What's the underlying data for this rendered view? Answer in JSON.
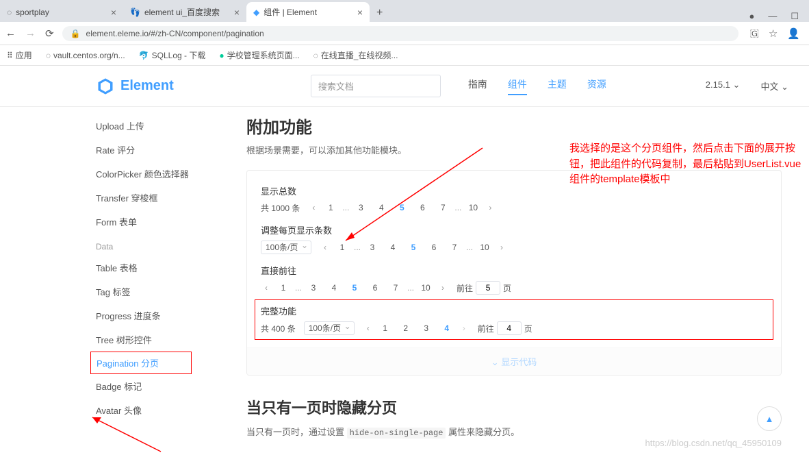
{
  "browser": {
    "tabs": [
      {
        "title": "sportplay"
      },
      {
        "title": "element ui_百度搜索"
      },
      {
        "title": "组件 | Element"
      }
    ],
    "url": "element.eleme.io/#/zh-CN/component/pagination",
    "bookmarks": [
      {
        "label": "应用"
      },
      {
        "label": "vault.centos.org/n..."
      },
      {
        "label": "SQLLog - 下载"
      },
      {
        "label": "学校管理系统页面..."
      },
      {
        "label": "在线直播_在线视频..."
      }
    ]
  },
  "header": {
    "brand": "Element",
    "search_placeholder": "搜索文档",
    "nav": [
      "指南",
      "组件",
      "主题",
      "资源"
    ],
    "version": "2.15.1",
    "lang": "中文"
  },
  "sidebar": {
    "items": [
      "Upload 上传",
      "Rate 评分",
      "ColorPicker 颜色选择器",
      "Transfer 穿梭框",
      "Form 表单"
    ],
    "group": "Data",
    "data_items": [
      "Table 表格",
      "Tag 标签",
      "Progress 进度条",
      "Tree 树形控件",
      "Pagination 分页",
      "Badge 标记",
      "Avatar 头像"
    ]
  },
  "main": {
    "section1": {
      "title": "附加功能",
      "desc": "根据场景需要，可以添加其他功能模块。"
    },
    "demo1": {
      "label": "显示总数",
      "total": "共 1000 条",
      "pages": [
        "1",
        "...",
        "3",
        "4",
        "5",
        "6",
        "7",
        "...",
        "10"
      ],
      "active": "5"
    },
    "demo2": {
      "label": "调整每页显示条数",
      "sizer": "100条/页",
      "pages": [
        "1",
        "...",
        "3",
        "4",
        "5",
        "6",
        "7",
        "...",
        "10"
      ],
      "active": "5"
    },
    "demo3": {
      "label": "直接前往",
      "pages": [
        "1",
        "...",
        "3",
        "4",
        "5",
        "6",
        "7",
        "...",
        "10"
      ],
      "active": "5",
      "jump_label": "前往",
      "jump_value": "5",
      "jump_suffix": "页"
    },
    "demo4": {
      "label": "完整功能",
      "total": "共 400 条",
      "sizer": "100条/页",
      "pages": [
        "1",
        "2",
        "3",
        "4"
      ],
      "active": "4",
      "jump_label": "前往",
      "jump_value": "4",
      "jump_suffix": "页"
    },
    "expand": "显示代码",
    "section2": {
      "title": "当只有一页时隐藏分页",
      "desc_prefix": "当只有一页时，通过设置 ",
      "code": "hide-on-single-page",
      "desc_suffix": " 属性来隐藏分页。"
    }
  },
  "annotation": "我选择的是这个分页组件，然后点击下面的展开按钮，把此组件的代码复制，最后粘贴到UserList.vue组件的template模板中",
  "watermark": "https://blog.csdn.net/qq_45950109"
}
